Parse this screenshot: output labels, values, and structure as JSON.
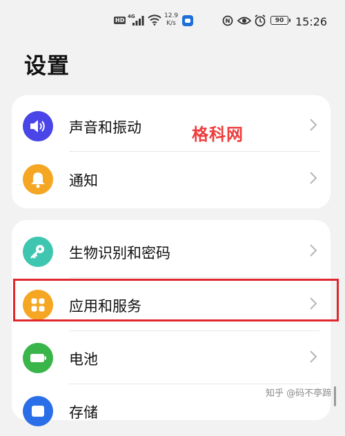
{
  "status_bar": {
    "hd": "HD",
    "network": "4G",
    "speed_value": "12.9",
    "speed_unit": "K/s",
    "battery": "90",
    "time": "15:26"
  },
  "page_title": "设置",
  "group1": {
    "items": [
      {
        "label": "声音和振动",
        "icon": "speaker-icon",
        "color": "#4a45e6"
      },
      {
        "label": "通知",
        "icon": "bell-icon",
        "color": "#f5a623"
      }
    ]
  },
  "group2": {
    "items": [
      {
        "label": "生物识别和密码",
        "icon": "key-icon",
        "color": "#3fc6b0"
      },
      {
        "label": "应用和服务",
        "icon": "apps-grid-icon",
        "color": "#f5a623"
      },
      {
        "label": "电池",
        "icon": "battery-icon",
        "color": "#39b54a"
      },
      {
        "label": "存储",
        "icon": "storage-icon",
        "color": "#2a6ee8"
      }
    ]
  },
  "highlight_color": "#e0262a",
  "watermark_top": "格科网",
  "watermark_bottom": "知乎 @码不亭蹄"
}
